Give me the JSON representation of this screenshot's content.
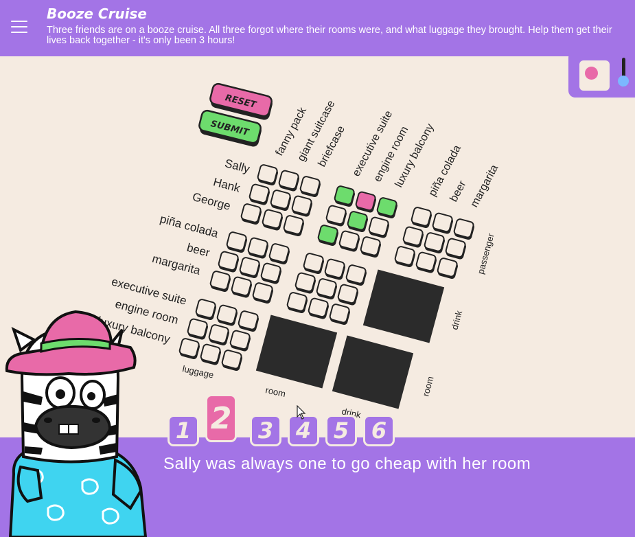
{
  "header": {
    "title": "Booze Cruise",
    "subtitle": "Three friends are on a booze cruise. All three forgot where their rooms were, and what luggage they brought. Help them get their lives back together - it's only been 3 hours!"
  },
  "controls": {
    "reset_label": "RESET",
    "submit_label": "SUBMIT"
  },
  "grid": {
    "row_names": [
      "Sally",
      "Hank",
      "George"
    ],
    "drink_rows": [
      "piña colada",
      "beer",
      "margarita"
    ],
    "room_rows": [
      "executive suite",
      "engine room",
      "luxury balcony"
    ],
    "luggage_cols": [
      "fanny pack",
      "giant suitcase",
      "briefcase"
    ],
    "room_cols": [
      "executive suite",
      "engine room",
      "luxury balcony"
    ],
    "drink_cols": [
      "piña colada",
      "beer",
      "margarita"
    ],
    "section_labels": {
      "passenger": "passenger",
      "drink_right": "drink",
      "room_right": "room",
      "luggage_bottom": "luggage",
      "room_bottom": "room",
      "drink_bottom": "drink"
    },
    "marks_passenger_room": [
      [
        "green",
        "pink",
        "green"
      ],
      [
        "empty",
        "green",
        "empty"
      ],
      [
        "green",
        "empty",
        "empty"
      ]
    ]
  },
  "clues": {
    "tabs": [
      "1",
      "2",
      "3",
      "4",
      "5",
      "6"
    ],
    "active_index": 1,
    "current_text": "Sally was always one to go cheap with her room"
  },
  "colors": {
    "purple": "#a374e6",
    "cream": "#f5ebe1",
    "pink": "#e86aa8",
    "green": "#6ddc6d",
    "dark": "#2b2b2b"
  }
}
